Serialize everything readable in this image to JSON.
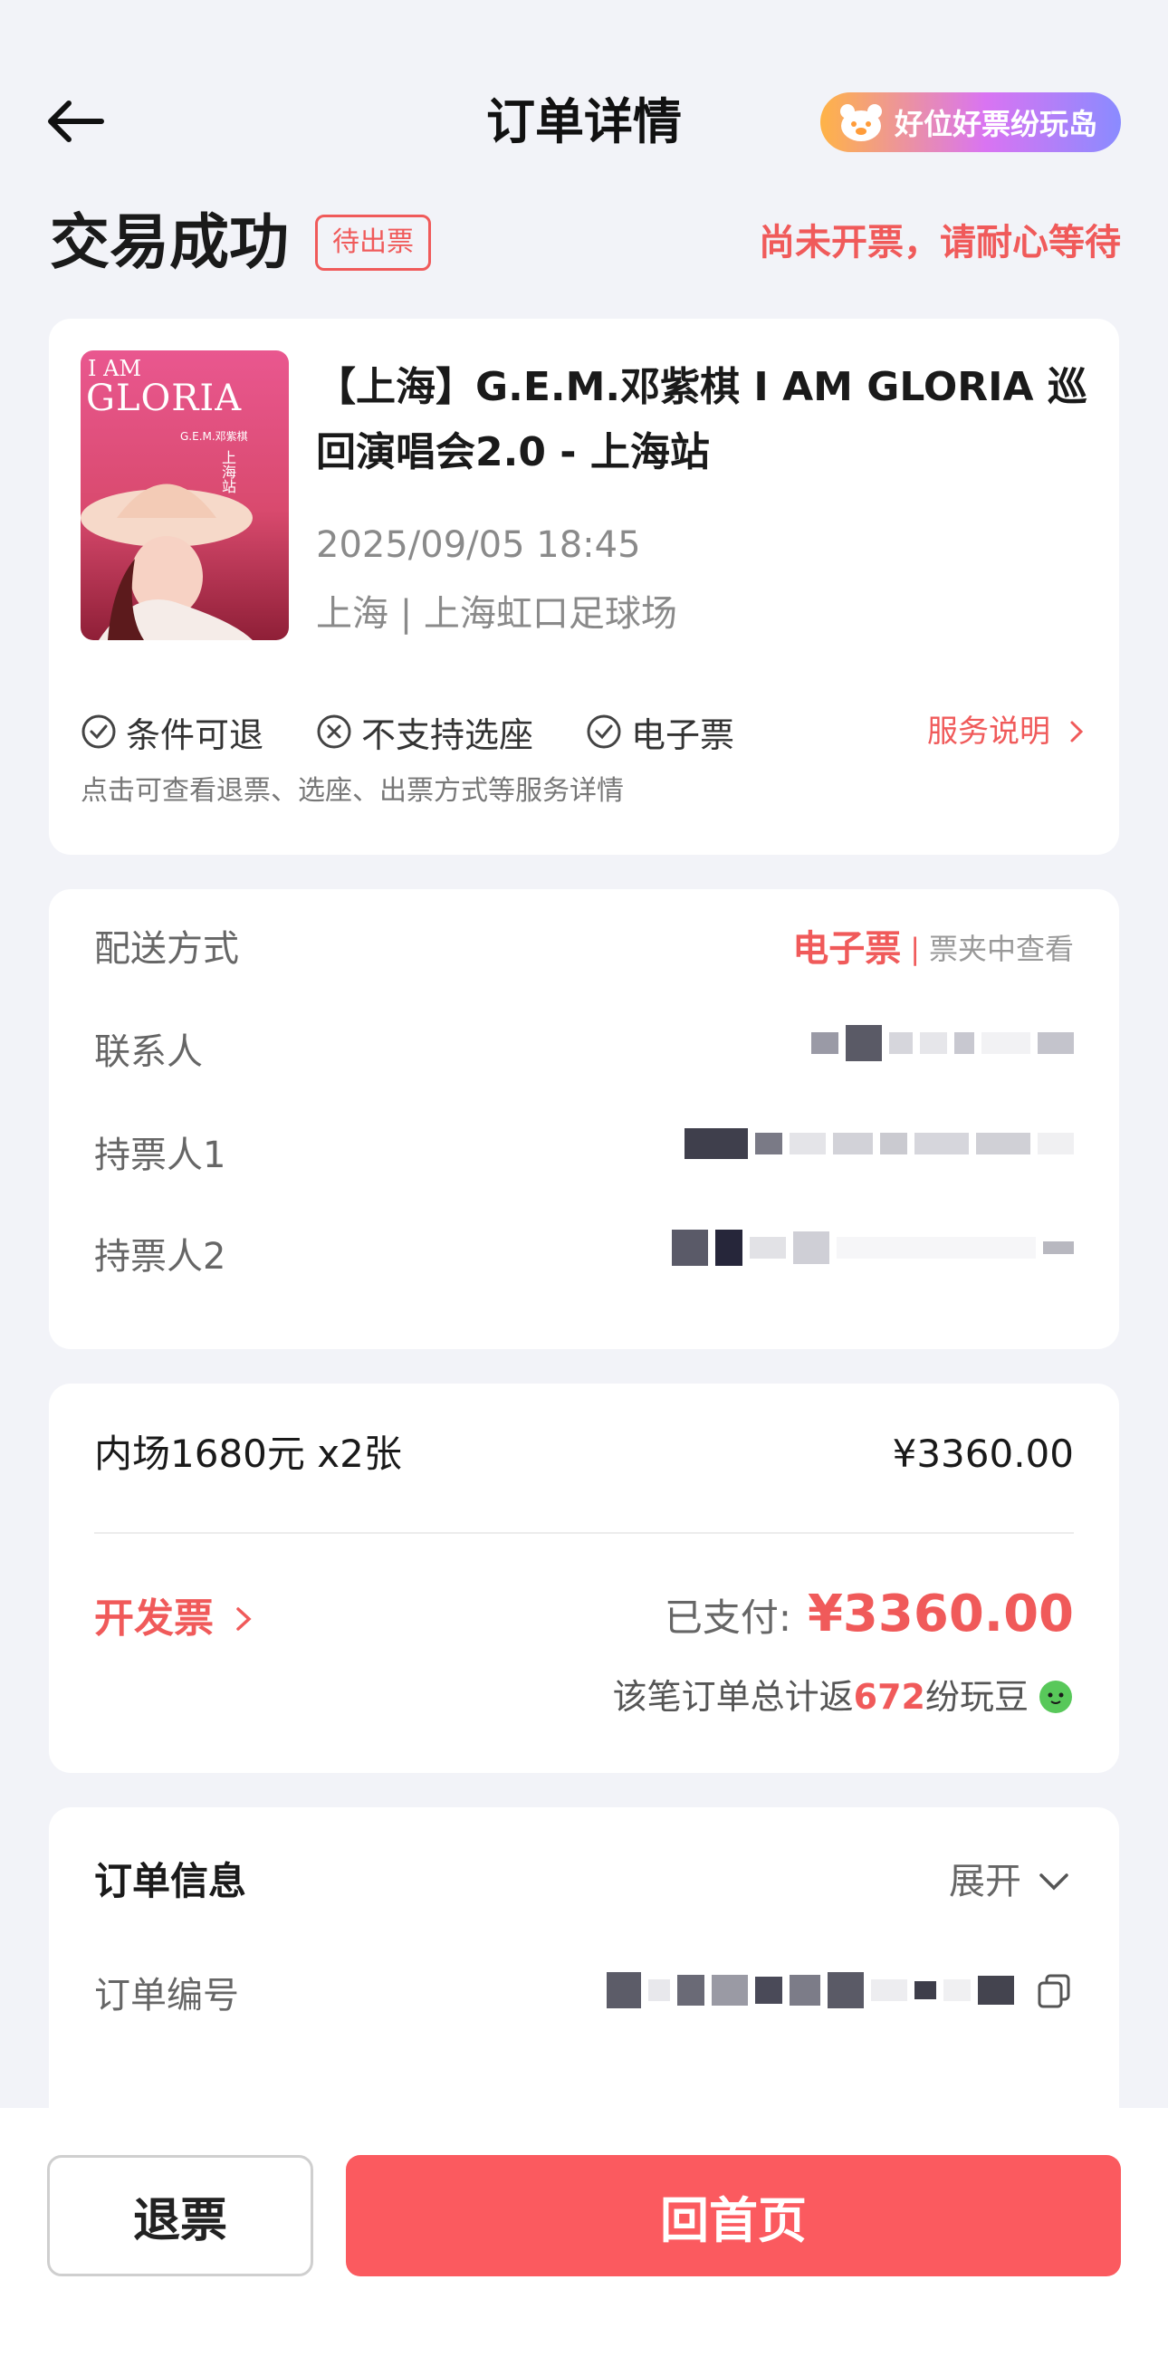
{
  "header": {
    "title": "订单详情",
    "brand_pill": "好位好票纷玩岛",
    "brand_gradient": [
      "#ffb347",
      "#d974f2",
      "#8a8bff"
    ]
  },
  "status": {
    "title": "交易成功",
    "badge": "待出票",
    "note": "尚未开票，请耐心等待"
  },
  "event": {
    "title": "【上海】G.E.M.邓紫棋 I AM GLORIA 巡回演唱会2.0 - 上海站",
    "datetime": "2025/09/05 18:45",
    "venue": "上海 | 上海虹口足球场",
    "poster_text": {
      "line1": "I AM",
      "line2": "GLORIA",
      "line3": "G.E.M.邓紫棋",
      "line4": "上海站"
    },
    "services": [
      {
        "icon": "check-circle-icon",
        "label": "条件可退"
      },
      {
        "icon": "x-circle-icon",
        "label": "不支持选座"
      },
      {
        "icon": "check-circle-icon",
        "label": "电子票"
      }
    ],
    "service_link": "服务说明",
    "service_hint": "点击可查看退票、选座、出票方式等服务详情"
  },
  "delivery": {
    "method_label": "配送方式",
    "method_value": "电子票",
    "method_separator": "|",
    "method_where": "票夹中查看",
    "contact_label": "联系人",
    "holder1_label": "持票人1",
    "holder2_label": "持票人2"
  },
  "price": {
    "line_label": "内场1680元 x2张",
    "line_value": "¥3360.00",
    "invoice": "开发票",
    "paid_label": "已支付:",
    "paid_amount": "¥3360.00",
    "bean_prefix": "该笔订单总计返",
    "bean_count": "672",
    "bean_suffix": "纷玩豆"
  },
  "order_info": {
    "title": "订单信息",
    "expand": "展开",
    "number_label": "订单编号"
  },
  "bottom": {
    "refund": "退票",
    "home": "回首页"
  },
  "colors": {
    "accent": "#f05a5a",
    "primary_button": "#fb5a5f",
    "background": "#f2f3f8"
  }
}
